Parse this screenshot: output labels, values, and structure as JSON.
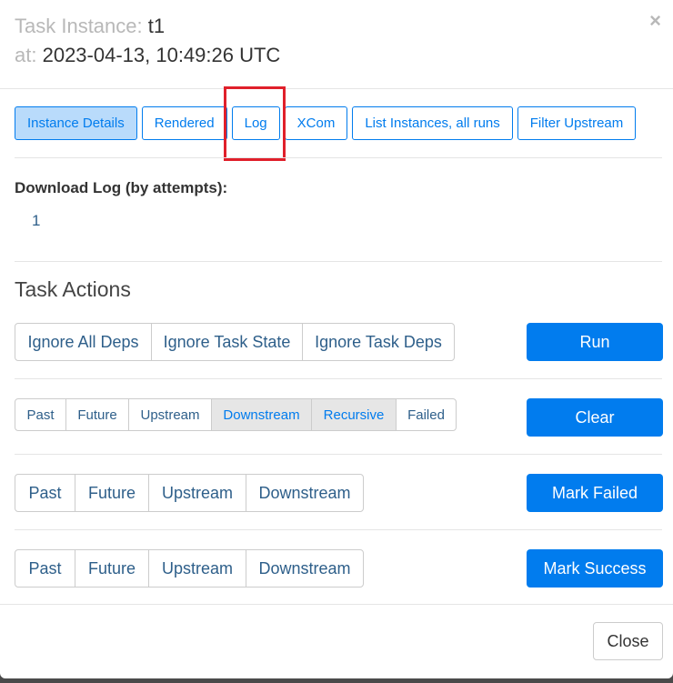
{
  "header": {
    "task_instance_label": "Task Instance:",
    "task_instance_value": "t1",
    "at_label": "at:",
    "at_value": "2023-04-13, 10:49:26 UTC",
    "close_glyph": "×"
  },
  "tabs": [
    {
      "label": "Instance Details",
      "active": true
    },
    {
      "label": "Rendered",
      "active": false
    },
    {
      "label": "Log",
      "active": false
    },
    {
      "label": "XCom",
      "active": false
    },
    {
      "label": "List Instances, all runs",
      "active": false
    },
    {
      "label": "Filter Upstream",
      "active": false
    }
  ],
  "download_log": {
    "label": "Download Log (by attempts):",
    "attempts": [
      "1"
    ]
  },
  "task_actions": {
    "title": "Task Actions",
    "run": {
      "options": [
        "Ignore All Deps",
        "Ignore Task State",
        "Ignore Task Deps"
      ],
      "button": "Run"
    },
    "clear": {
      "options": [
        "Past",
        "Future",
        "Upstream",
        "Downstream",
        "Recursive",
        "Failed"
      ],
      "selected": [
        "Downstream",
        "Recursive"
      ],
      "button": "Clear"
    },
    "mark_failed": {
      "options": [
        "Past",
        "Future",
        "Upstream",
        "Downstream"
      ],
      "button": "Mark Failed"
    },
    "mark_success": {
      "options": [
        "Past",
        "Future",
        "Upstream",
        "Downstream"
      ],
      "button": "Mark Success"
    }
  },
  "footer": {
    "close_label": "Close"
  },
  "colors": {
    "primary": "#017cee",
    "active_tab_bg": "#b9dbfb",
    "highlight_box": "#e0202b"
  }
}
